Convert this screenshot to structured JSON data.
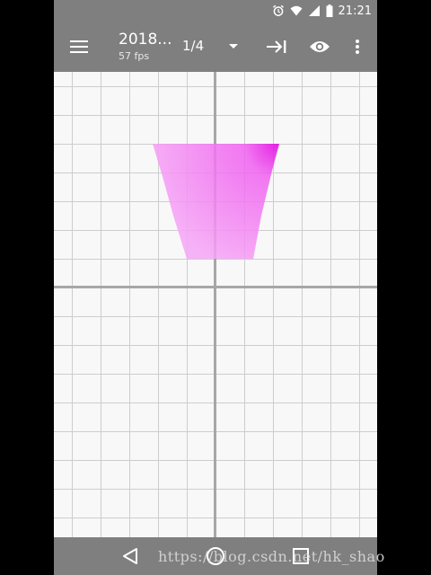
{
  "status_bar": {
    "time": "21:21",
    "icons": [
      "alarm-icon",
      "wifi-icon",
      "signal-icon",
      "battery-icon"
    ]
  },
  "toolbar": {
    "title": "2018...",
    "subtitle": "57 fps",
    "page_indicator": "1/4",
    "icons": [
      "menu-icon",
      "dropdown-icon",
      "skip-to-end-icon",
      "eye-icon",
      "more-vert-icon"
    ]
  },
  "canvas": {
    "grid_color": "#cdcdcd",
    "axis_color": "#a7a7a7",
    "shape": {
      "type": "trapezoid",
      "fill_color": "#f06cf0",
      "highlight_color": "#e000e0"
    }
  },
  "nav_bar": {
    "icons": [
      "back-icon",
      "home-icon",
      "recents-icon"
    ]
  },
  "watermark": {
    "text": "https://blog.csdn.net/hk_shao"
  },
  "colors": {
    "bar_background": "#7f7f7f",
    "canvas_background": "#f8f8f8"
  }
}
